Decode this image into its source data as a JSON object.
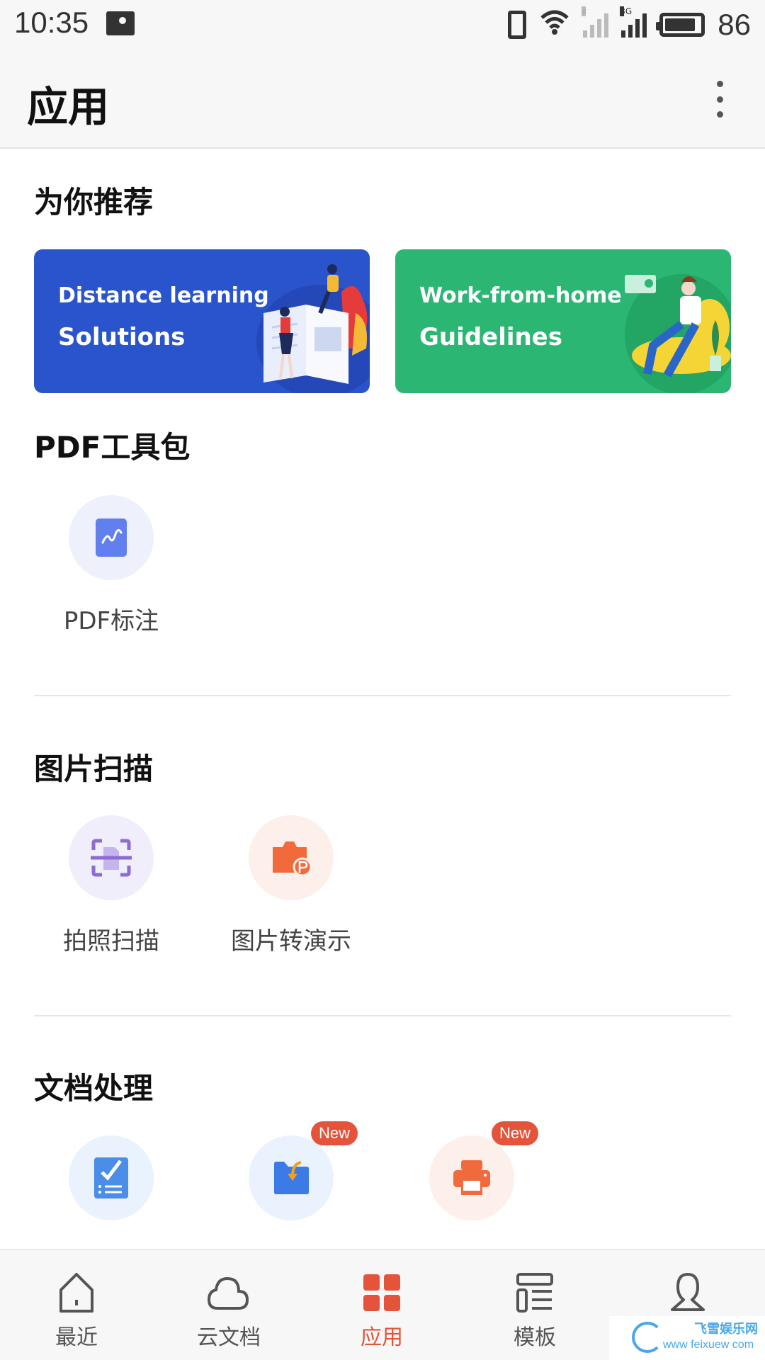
{
  "status_bar": {
    "time": "10:35",
    "network_tag_sim1": "x",
    "network_tag_sim2": "3G",
    "battery_percent": "86",
    "battery_level": 0.86
  },
  "header": {
    "title": "应用",
    "more_icon": "more-vertical-icon"
  },
  "recommend": {
    "title": "为你推荐",
    "banners": [
      {
        "line1": "Distance learning",
        "line2": "Solutions",
        "color": "#2a54cb"
      },
      {
        "line1": "Work-from-home",
        "line2": "Guidelines",
        "color": "#2bb673"
      }
    ]
  },
  "sections": [
    {
      "title": "PDF工具包",
      "tools": [
        {
          "label": "PDF标注",
          "icon": "pdf-annotate-icon",
          "bg": "#eef0fc",
          "color": "#6180ee",
          "badge": ""
        }
      ]
    },
    {
      "title": "图片扫描",
      "tools": [
        {
          "label": "拍照扫描",
          "icon": "scan-icon",
          "bg": "#f1eefb",
          "color": "#8c6bd3",
          "badge": ""
        },
        {
          "label": "图片转演示",
          "icon": "camera-ppt-icon",
          "bg": "#fdefe9",
          "color": "#f06a3c",
          "badge": ""
        }
      ]
    },
    {
      "title": "文档处理",
      "tools": [
        {
          "label": "",
          "icon": "doc-checklist-icon",
          "bg": "#eaf2fd",
          "color": "#4a8ee8",
          "badge": ""
        },
        {
          "label": "",
          "icon": "folder-import-icon",
          "bg": "#eaf2fd",
          "color": "#3c7be6",
          "badge": "New"
        },
        {
          "label": "",
          "icon": "printer-icon",
          "bg": "#fdefe9",
          "color": "#f06a3c",
          "badge": "New"
        }
      ]
    }
  ],
  "bottom_nav": {
    "items": [
      {
        "label": "最近",
        "icon": "home-icon",
        "active": false
      },
      {
        "label": "云文档",
        "icon": "cloud-icon",
        "active": false
      },
      {
        "label": "应用",
        "icon": "apps-grid-icon",
        "active": true
      },
      {
        "label": "模板",
        "icon": "template-icon",
        "active": false
      },
      {
        "label": "",
        "icon": "person-icon",
        "active": false
      }
    ],
    "active_color": "#e4533a"
  },
  "watermark": {
    "title": "飞雪娱乐网",
    "url": "www feixuew com"
  }
}
